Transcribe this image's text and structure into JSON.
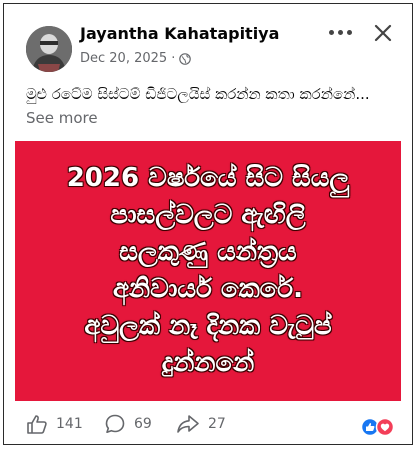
{
  "post": {
    "author": "Jayantha Kahatapitiya",
    "date": "Dec 20, 2025",
    "separator": "·",
    "caption": "මුළු රටේම සිස්ටම් ඩිජිටලයිස් කරන්න කතා කරන්නේ...",
    "see_more": "See more",
    "banner_lines": [
      "2026 වර්ෂයේ සිට සියලු",
      "පාසල්වලට ඇඟිලි",
      "සලකුණු යන්ත්‍රය",
      "අනිවාර්ය කෙරේ.",
      "අවුලක් නෑ දිනක වැටුප්",
      "දුන්නනේ"
    ],
    "banner_color": "#e5173b"
  },
  "footer": {
    "likes": "141",
    "comments": "69",
    "shares": "27"
  },
  "icons": {
    "privacy": "globe-icon",
    "more": "more-dots-icon",
    "close": "close-icon",
    "like": "thumbs-up-icon",
    "comment": "comment-icon",
    "share": "share-icon",
    "reactions": "like-love-reactions-icon"
  }
}
